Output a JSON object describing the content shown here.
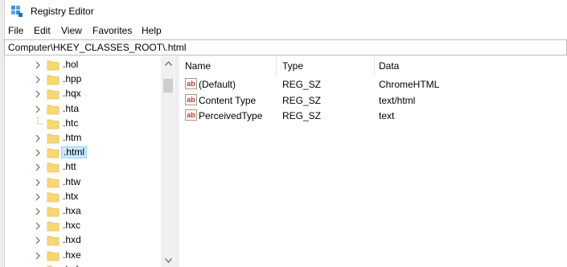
{
  "window": {
    "title": "Registry Editor"
  },
  "menu": {
    "items": [
      "File",
      "Edit",
      "View",
      "Favorites",
      "Help"
    ]
  },
  "address": {
    "path": "Computer\\HKEY_CLASSES_ROOT\\.html"
  },
  "tree": {
    "items": [
      {
        "label": ".hol",
        "expandable": true,
        "selected": false
      },
      {
        "label": ".hpp",
        "expandable": true,
        "selected": false
      },
      {
        "label": ".hqx",
        "expandable": true,
        "selected": false
      },
      {
        "label": ".hta",
        "expandable": true,
        "selected": false
      },
      {
        "label": ".htc",
        "expandable": false,
        "selected": false
      },
      {
        "label": ".htm",
        "expandable": true,
        "selected": false
      },
      {
        "label": ".html",
        "expandable": true,
        "selected": true
      },
      {
        "label": ".htt",
        "expandable": true,
        "selected": false
      },
      {
        "label": ".htw",
        "expandable": true,
        "selected": false
      },
      {
        "label": ".htx",
        "expandable": true,
        "selected": false
      },
      {
        "label": ".hxa",
        "expandable": true,
        "selected": false
      },
      {
        "label": ".hxc",
        "expandable": true,
        "selected": false
      },
      {
        "label": ".hxd",
        "expandable": true,
        "selected": false
      },
      {
        "label": ".hxe",
        "expandable": true,
        "selected": false
      },
      {
        "label": ".hxf",
        "expandable": true,
        "selected": false
      }
    ]
  },
  "list": {
    "columns": {
      "name": "Name",
      "type": "Type",
      "data": "Data"
    },
    "rows": [
      {
        "name": "(Default)",
        "type": "REG_SZ",
        "data": "ChromeHTML"
      },
      {
        "name": "Content Type",
        "type": "REG_SZ",
        "data": "text/html"
      },
      {
        "name": "PerceivedType",
        "type": "REG_SZ",
        "data": "text"
      }
    ]
  },
  "colors": {
    "folder": "#f8d775",
    "folder_tab": "#e8bf4f",
    "selection_bg": "#cce8ff",
    "selection_border": "#99d1ff",
    "string_icon": "#c0392b"
  }
}
